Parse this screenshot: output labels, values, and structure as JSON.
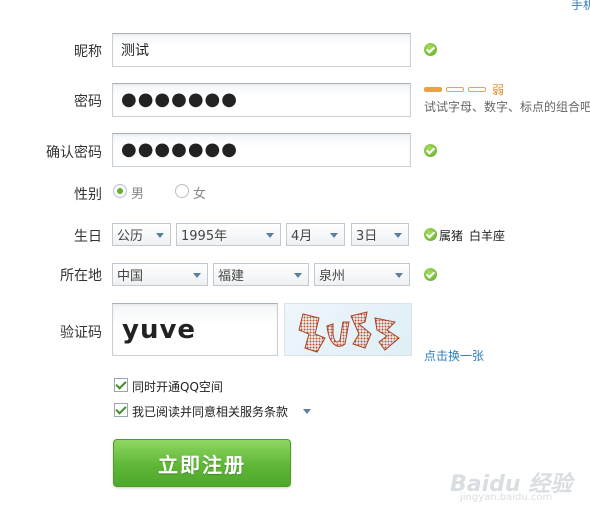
{
  "top_right_link": "手机",
  "form": {
    "nickname": {
      "label": "昵称",
      "value": "测试"
    },
    "password": {
      "label": "密码",
      "value": "●●●●●●●",
      "strength_label": "弱",
      "hint": "试试字母、数字、标点的组合吧"
    },
    "confirm_password": {
      "label": "确认密码",
      "value": "●●●●●●●"
    },
    "gender": {
      "label": "性别",
      "options": [
        "男",
        "女"
      ],
      "selected": "男"
    },
    "birthday": {
      "label": "生日",
      "calendar": "公历",
      "year": "1995年",
      "month": "4月",
      "day": "3日",
      "zodiac": "属猪",
      "constellation": "白羊座"
    },
    "location": {
      "label": "所在地",
      "country": "中国",
      "province": "福建",
      "city": "泉州"
    },
    "captcha": {
      "label": "验证码",
      "value": "yuve",
      "refresh_link": "点击换一张"
    },
    "options": {
      "qzone": {
        "label": "同时开通QQ空间",
        "checked": true
      },
      "terms": {
        "label": "我已阅读并同意相关服务条款",
        "checked": true
      }
    },
    "submit_label": "立即注册"
  },
  "colors": {
    "accent_green": "#5fb637",
    "link_blue": "#2f7fbf",
    "strength_orange": "#f0a040"
  },
  "watermark": {
    "text": "Baidu 经验",
    "url": "jingyan.baidu.com"
  }
}
